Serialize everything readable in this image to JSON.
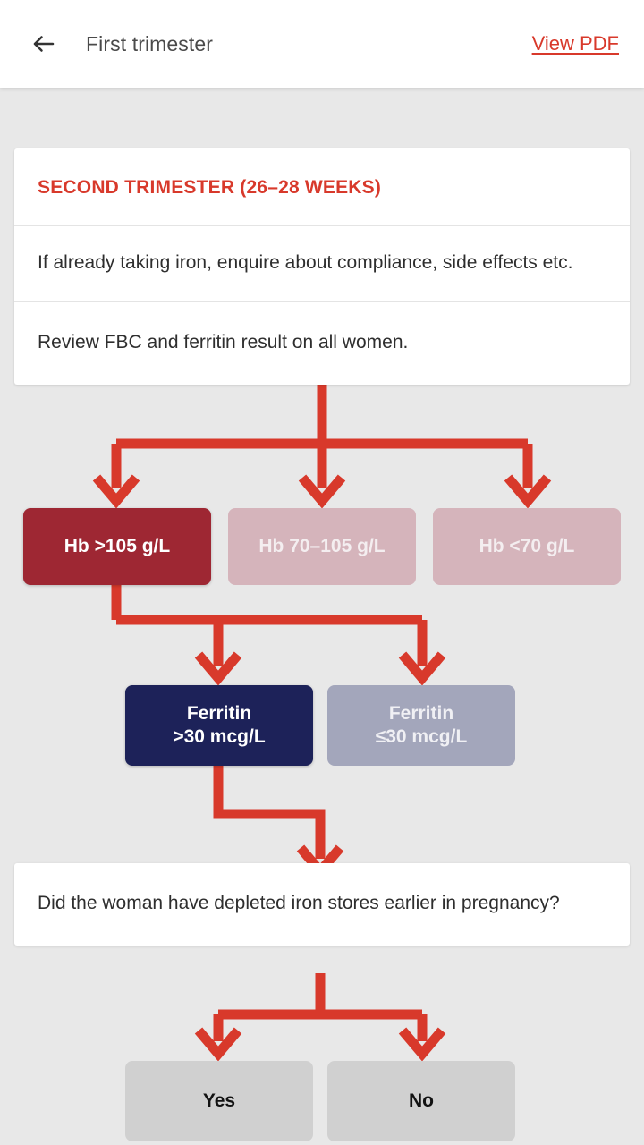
{
  "appbar": {
    "back_icon": "arrow-left-icon",
    "title": "First trimester",
    "view_pdf_label": "View PDF"
  },
  "colors": {
    "accent_red": "#d8392b",
    "dark_red": "#9e2733",
    "muted_pink": "#d5b4bb",
    "navy": "#1d2259",
    "muted_navy": "#a3a6bb",
    "answer_grey": "#d0d0d0",
    "page_bg": "#e8e8e8",
    "card_bg": "#ffffff"
  },
  "card_top": {
    "header": "SECOND TRIMESTER (26–28 WEEKS)",
    "rows": [
      "If already taking iron, enquire about compliance, side effects etc.",
      "Review FBC and ferritin result on all women."
    ]
  },
  "hb_options": [
    {
      "label": "Hb >105 g/L",
      "state": "selected"
    },
    {
      "label": "Hb 70–105 g/L",
      "state": "muted"
    },
    {
      "label": "Hb <70 g/L",
      "state": "muted"
    }
  ],
  "ferritin_options": [
    {
      "line1": "Ferritin",
      "line2": ">30 mcg/L",
      "state": "selected"
    },
    {
      "line1": "Ferritin",
      "line2": "≤30 mcg/L",
      "state": "muted"
    }
  ],
  "question": {
    "text": "Did the woman have depleted iron stores earlier in pregnancy?"
  },
  "answers": [
    {
      "label": "Yes"
    },
    {
      "label": "No"
    }
  ]
}
